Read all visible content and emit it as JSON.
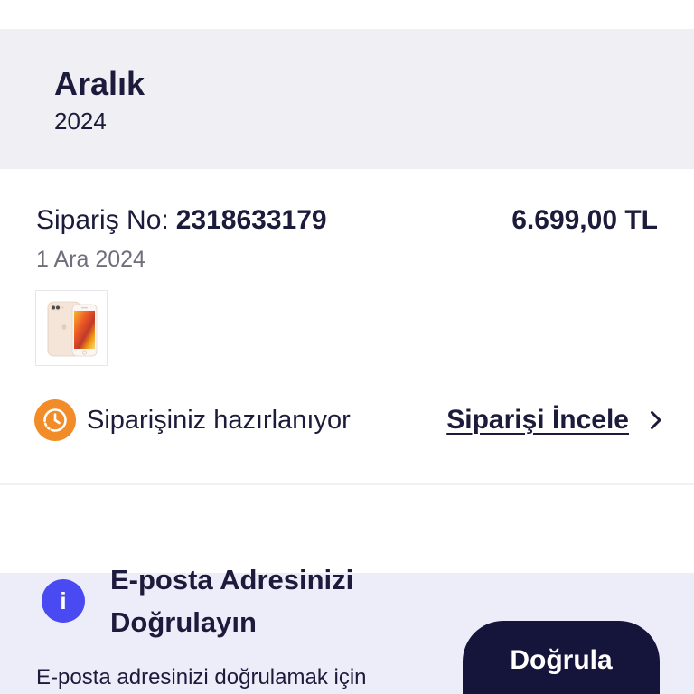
{
  "colors": {
    "text": "#1c1b3b",
    "muted": "#6f6e7c",
    "section_bg": "#efeff4",
    "banner_bg": "#ededfa",
    "status_orange": "#f28c28",
    "info_blue": "#4a4af2",
    "button_bg": "#15143b"
  },
  "month_group": {
    "month": "Aralık",
    "year": "2024"
  },
  "order": {
    "number_label": "Sipariş No:",
    "number": "2318633179",
    "total": "6.699,00 TL",
    "date": "1 Ara 2024",
    "thumbnail_icon": "phone-product-image",
    "status": {
      "icon": "clock-icon",
      "text": "Siparişiniz hazırlanıyor"
    },
    "details_link": {
      "label": "Siparişi İncele",
      "icon": "chevron-right-icon"
    }
  },
  "email_verification": {
    "icon": "info-icon",
    "icon_glyph": "i",
    "title": "E-posta Adresinizi Doğrulayın",
    "description": "E-posta adresinizi doğrulamak için",
    "button_label": "Doğrula"
  }
}
